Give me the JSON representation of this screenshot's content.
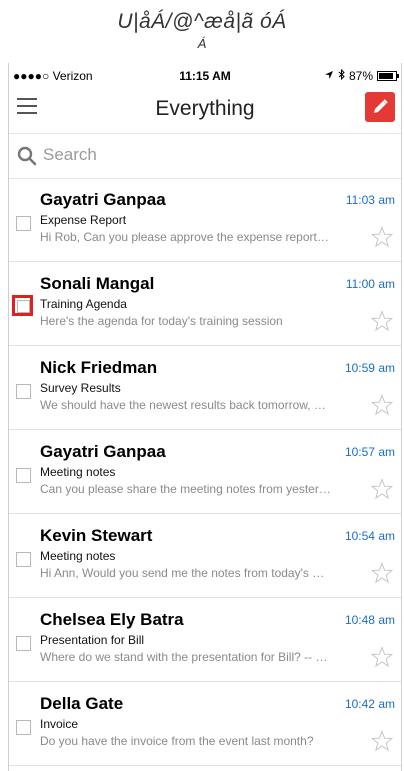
{
  "caption": {
    "line1": "U|åÁ/@^æå|ã óÁ",
    "line2": "Á"
  },
  "status_bar": {
    "carrier": "●●●●○ Verizon",
    "time": "11:15 AM",
    "battery": "87%",
    "battery_level": 0.87
  },
  "nav": {
    "title": "Everything"
  },
  "search": {
    "placeholder": "Search"
  },
  "emails": [
    {
      "sender": "Gayatri Ganpaa",
      "time": "11:03 am",
      "subject": "Expense Report",
      "preview": "Hi Rob, Can you please approve the expense report…"
    },
    {
      "sender": "Sonali Mangal",
      "time": "11:00 am",
      "subject": "Training Agenda",
      "preview": "Here's the agenda for today's training session"
    },
    {
      "sender": "Nick Friedman",
      "time": "10:59 am",
      "subject": "Survey Results",
      "preview": "We should have the newest results back tomorrow, …"
    },
    {
      "sender": "Gayatri Ganpaa",
      "time": "10:57 am",
      "subject": "Meeting notes",
      "preview": "Can you please share the meeting notes from yester…"
    },
    {
      "sender": "Kevin Stewart",
      "time": "10:54 am",
      "subject": "Meeting notes",
      "preview": "Hi Ann, Would you send me the notes from today's …"
    },
    {
      "sender": "Chelsea Ely Batra",
      "time": "10:48 am",
      "subject": "Presentation for Bill",
      "preview": "Where do we stand with the presentation for Bill? -- …"
    },
    {
      "sender": "Della Gate",
      "time": "10:42 am",
      "subject": "Invoice",
      "preview": "Do you have the invoice from the event last month?"
    }
  ],
  "highlighted_row": 1
}
